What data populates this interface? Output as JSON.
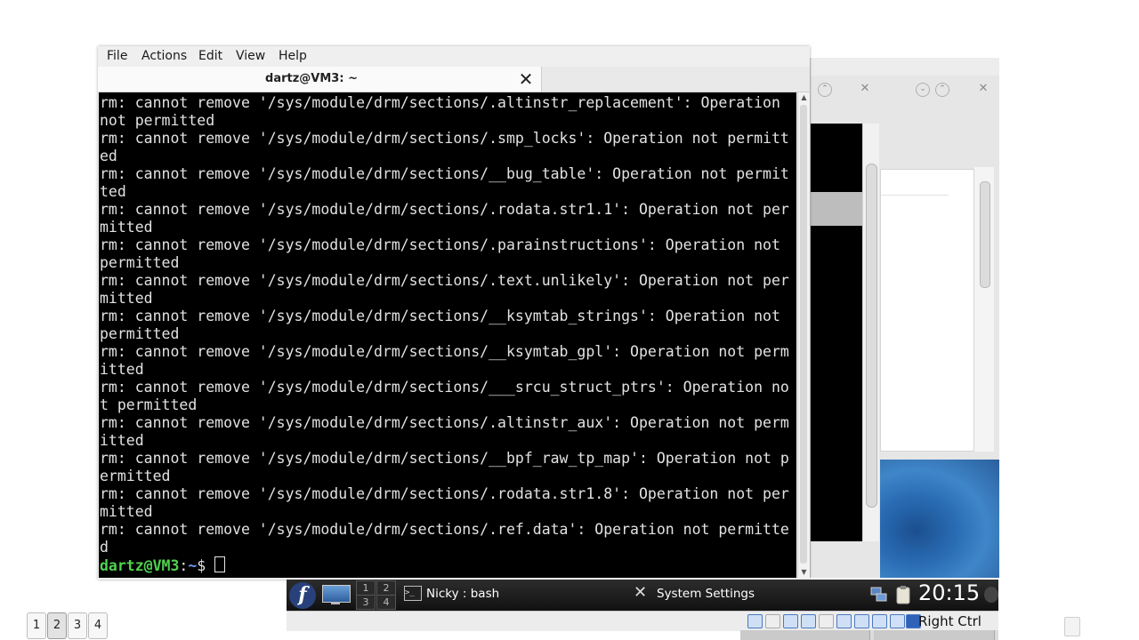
{
  "menubar": {
    "items": [
      {
        "label": "File"
      },
      {
        "label": "Actions"
      },
      {
        "label": "Edit"
      },
      {
        "label": "View"
      },
      {
        "label": "Help"
      }
    ]
  },
  "tab": {
    "title": "dartz@VM3: ~",
    "close_glyph": "✕"
  },
  "terminal": {
    "lines": [
      "rm: cannot remove '/sys/module/drm/sections/.altinstr_replacement': Operation",
      "not permitted",
      "rm: cannot remove '/sys/module/drm/sections/.smp_locks': Operation not permitt",
      "ed",
      "rm: cannot remove '/sys/module/drm/sections/__bug_table': Operation not permit",
      "ted",
      "rm: cannot remove '/sys/module/drm/sections/.rodata.str1.1': Operation not per",
      "mitted",
      "rm: cannot remove '/sys/module/drm/sections/.parainstructions': Operation not",
      "permitted",
      "rm: cannot remove '/sys/module/drm/sections/.text.unlikely': Operation not per",
      "mitted",
      "rm: cannot remove '/sys/module/drm/sections/__ksymtab_strings': Operation not",
      "permitted",
      "rm: cannot remove '/sys/module/drm/sections/__ksymtab_gpl': Operation not perm",
      "itted",
      "rm: cannot remove '/sys/module/drm/sections/___srcu_struct_ptrs': Operation no",
      "t permitted",
      "rm: cannot remove '/sys/module/drm/sections/.altinstr_aux': Operation not perm",
      "itted",
      "rm: cannot remove '/sys/module/drm/sections/__bpf_raw_tp_map': Operation not p",
      "ermitted",
      "rm: cannot remove '/sys/module/drm/sections/.rodata.str1.8': Operation not per",
      "mitted",
      "rm: cannot remove '/sys/module/drm/sections/.ref.data': Operation not permitte",
      "d"
    ],
    "prompt": {
      "user_host": "dartz@VM3",
      "separator": ":",
      "path": "~",
      "symbol": "$ "
    }
  },
  "taskbar": {
    "pager": [
      "1",
      "2",
      "3",
      "4"
    ],
    "tasks": [
      {
        "label": "Nicky : bash"
      },
      {
        "label": "System Settings"
      }
    ],
    "clock": "20:15",
    "fedora_glyph": "f",
    "terminal_glyph": ">_",
    "wrench_glyph": "✕"
  },
  "vm_status": {
    "host_key": "Right Ctrl"
  },
  "desktops": [
    "1",
    "2",
    "3",
    "4"
  ],
  "window_controls": {
    "up": "⌃",
    "down": "⌄",
    "close": "✕"
  },
  "colors": {
    "prompt_user": "#4fd14f",
    "prompt_path": "#6f9bff",
    "panel": "#1b1b1b"
  }
}
